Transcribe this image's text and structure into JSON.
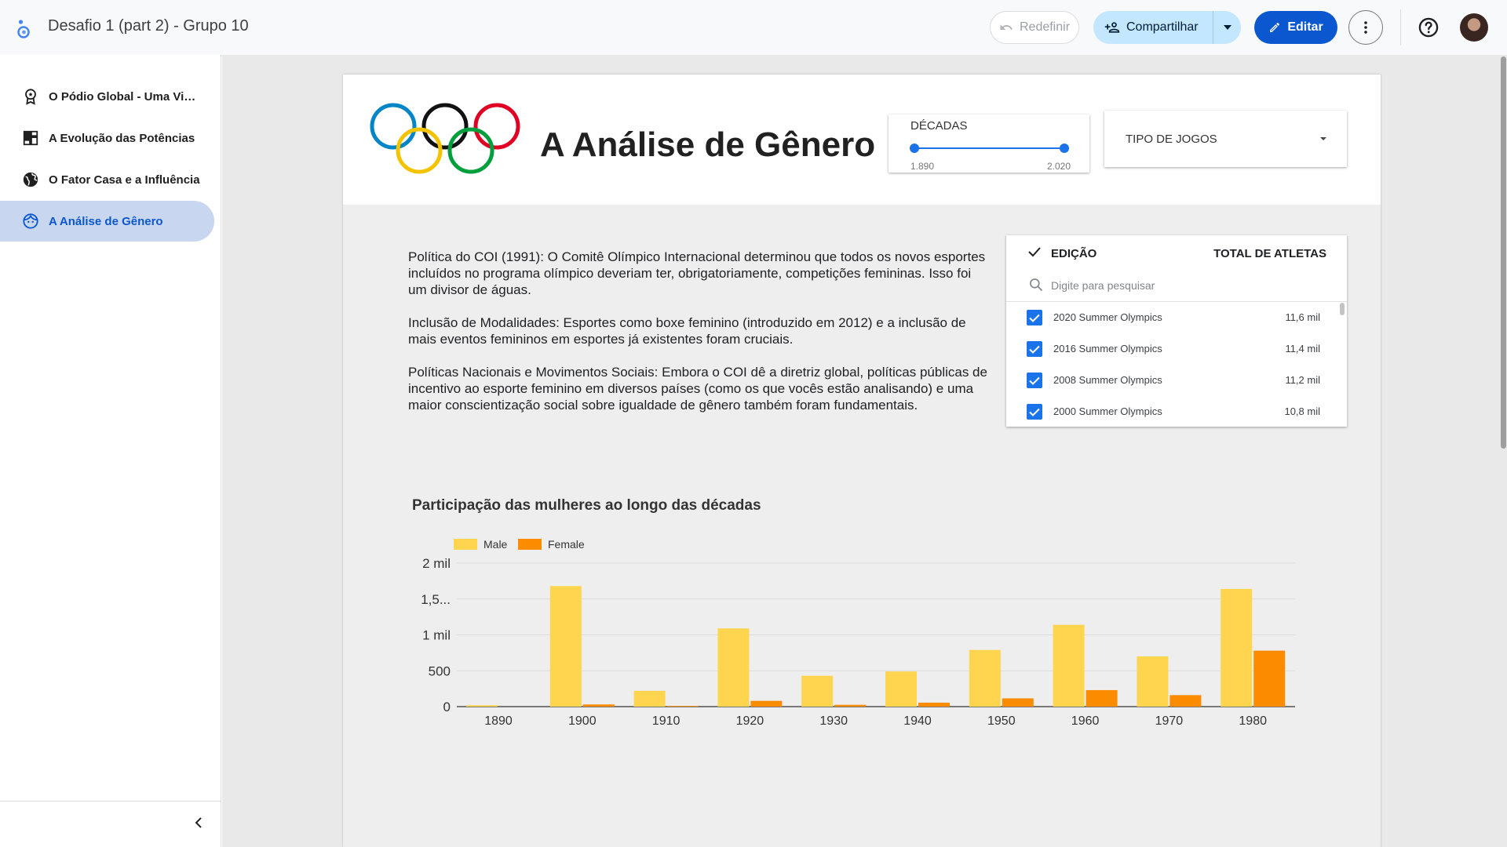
{
  "app": {
    "title": "Desafio 1 (part 2) - Grupo 10",
    "reset_label": "Redefinir",
    "share_label": "Compartilhar",
    "edit_label": "Editar"
  },
  "sidebar": {
    "items": [
      {
        "label": "O Pódio Global - Uma Visão Geral",
        "icon": "award-icon",
        "active": false
      },
      {
        "label": "A Evolução das Potências",
        "icon": "dashboard-icon",
        "active": false
      },
      {
        "label": "O Fator Casa e a Influência",
        "icon": "globe-icon",
        "active": false
      },
      {
        "label": "A Análise de Gênero",
        "icon": "face-icon",
        "active": true
      }
    ]
  },
  "report": {
    "title": "A Análise de Gênero",
    "slider": {
      "label": "DÉCADAS",
      "min": "1.890",
      "max": "2.020"
    },
    "dropdown": {
      "label": "TIPO DE JOGOS"
    },
    "paragraphs": [
      "Política do COI (1991): O Comitê Olímpico Internacional determinou que todos os novos esportes incluídos no programa olímpico deveriam ter, obrigatoriamente, competições femininas. Isso foi um divisor de águas.",
      "Inclusão de Modalidades: Esportes como boxe feminino (introduzido em 2012) e a inclusão de mais eventos femininos em esportes já existentes foram cruciais.",
      "Políticas Nacionais e Movimentos Sociais: Embora o COI dê a diretriz global, políticas públicas de incentivo ao esporte feminino em diversos países (como os que vocês estão analisando) e uma maior conscientização social sobre igualdade de gênero também foram fundamentais."
    ],
    "table": {
      "col1": "EDIÇÃO",
      "col2": "TOTAL DE ATLETAS",
      "search_placeholder": "Digite para pesquisar",
      "rows": [
        {
          "name": "2020 Summer Olympics",
          "value": "11,6 mil"
        },
        {
          "name": "2016 Summer Olympics",
          "value": "11,4 mil"
        },
        {
          "name": "2008 Summer Olympics",
          "value": "11,2 mil"
        },
        {
          "name": "2000 Summer Olympics",
          "value": "10,8 mil"
        }
      ]
    }
  },
  "colors": {
    "male": "#ffd54f",
    "female": "#fb8c00",
    "accent": "#0b57d0"
  },
  "chart_data": {
    "type": "bar",
    "title": "Participação das mulheres ao longo das décadas",
    "categories": [
      "1890",
      "1900",
      "1910",
      "1920",
      "1930",
      "1940",
      "1950",
      "1960",
      "1970",
      "1980"
    ],
    "series": [
      {
        "name": "Male",
        "values": [
          20,
          1680,
          220,
          1090,
          430,
          490,
          790,
          1140,
          700,
          1640
        ]
      },
      {
        "name": "Female",
        "values": [
          0,
          30,
          10,
          80,
          25,
          55,
          115,
          230,
          160,
          780
        ]
      }
    ],
    "yticks": [
      "0",
      "500",
      "1 mil",
      "1,5...",
      "2 mil"
    ],
    "ylim": [
      0,
      2000
    ],
    "legend": "top-left",
    "grid": true
  }
}
